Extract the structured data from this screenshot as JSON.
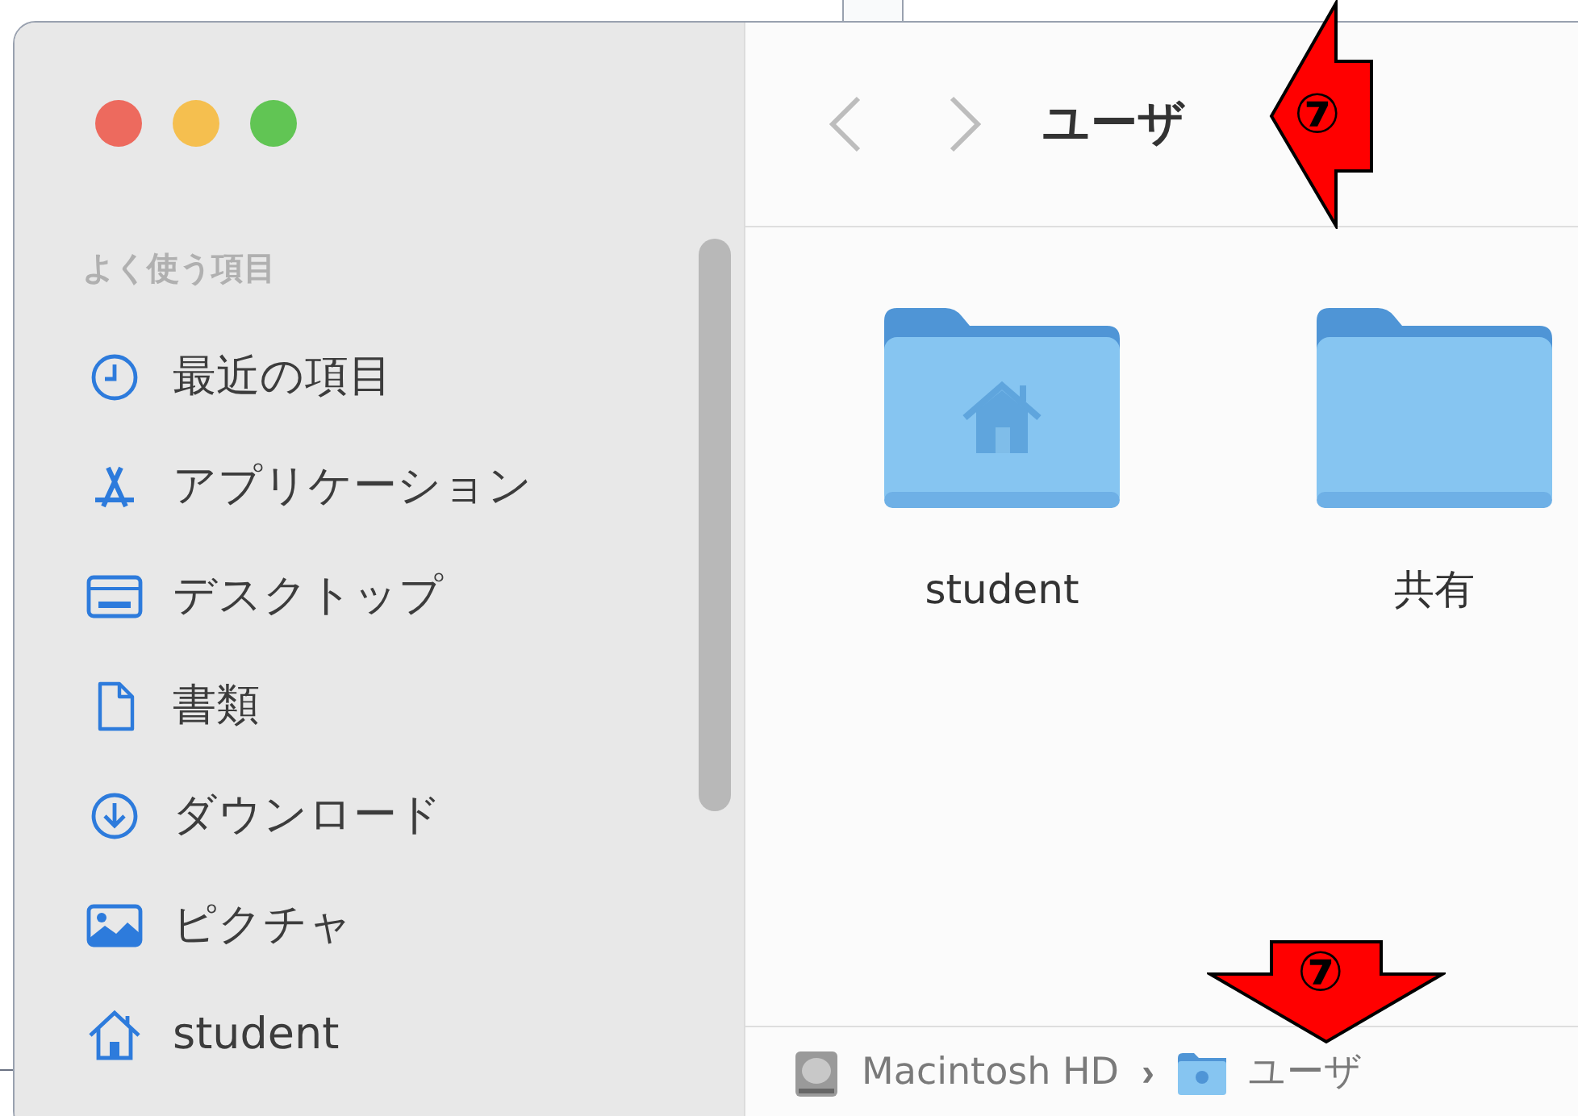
{
  "window": {
    "traffic_lights": [
      {
        "color": "#ed6a5e"
      },
      {
        "color": "#f5bf4f"
      },
      {
        "color": "#61c554"
      }
    ]
  },
  "sidebar": {
    "section": "よく使う項目",
    "items": [
      {
        "label": "最近の項目",
        "kind": "clock"
      },
      {
        "label": "アプリケーション",
        "kind": "apps"
      },
      {
        "label": "デスクトップ",
        "kind": "desktop"
      },
      {
        "label": "書類",
        "kind": "document"
      },
      {
        "label": "ダウンロード",
        "kind": "download"
      },
      {
        "label": "ピクチャ",
        "kind": "pictures"
      },
      {
        "label": "student",
        "kind": "home"
      }
    ]
  },
  "toolbar": {
    "title": "ユーザ"
  },
  "items": [
    {
      "name": "student",
      "kind": "home"
    },
    {
      "name": "共有",
      "kind": "plain"
    }
  ],
  "path_bar": {
    "separator": "›",
    "segments": [
      {
        "label": "Macintosh HD",
        "kind": "disk"
      },
      {
        "label": "ユーザ",
        "kind": "folder"
      }
    ]
  },
  "annotations": [
    {
      "label": "⑦",
      "kind": "left"
    },
    {
      "label": "⑦",
      "kind": "down"
    }
  ]
}
